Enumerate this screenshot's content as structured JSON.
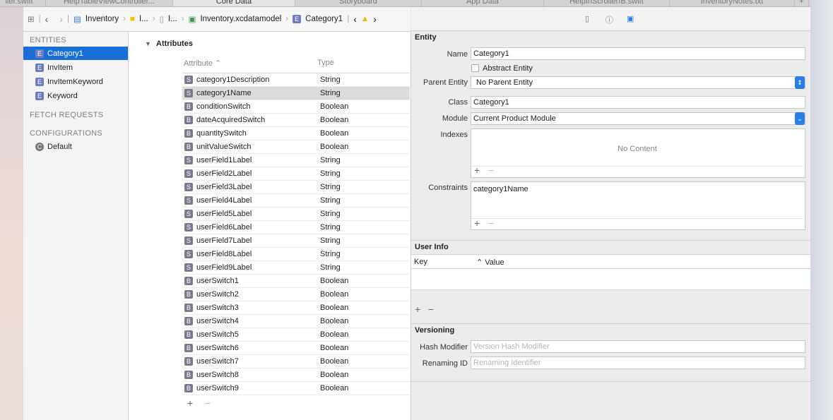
{
  "tabs": [
    "ller.swift",
    "HelpTableViewController...",
    "Core Data",
    "Storyboard",
    "App Data",
    "HelpInScrollerIB.swift",
    "InventoryNotes.txt"
  ],
  "active_tab": 2,
  "breadcrumb": [
    "Inventory",
    "I...",
    "I...",
    "Inventory.xcdatamodel",
    "Category1"
  ],
  "sidebar": {
    "entities_header": "ENTITIES",
    "entities": [
      "Category1",
      "InvItem",
      "InvItemKeyword",
      "Keyword"
    ],
    "selected": 0,
    "fetch_header": "FETCH REQUESTS",
    "config_header": "CONFIGURATIONS",
    "configs": [
      "Default"
    ]
  },
  "attributes": {
    "title": "Attributes",
    "col_attribute": "Attribute",
    "col_type": "Type",
    "selected": 1,
    "rows": [
      [
        "S",
        "category1Description",
        "String"
      ],
      [
        "S",
        "category1Name",
        "String"
      ],
      [
        "B",
        "conditionSwitch",
        "Boolean"
      ],
      [
        "B",
        "dateAcquiredSwitch",
        "Boolean"
      ],
      [
        "B",
        "quantitySwitch",
        "Boolean"
      ],
      [
        "B",
        "unitValueSwitch",
        "Boolean"
      ],
      [
        "S",
        "userField1Label",
        "String"
      ],
      [
        "S",
        "userField2Label",
        "String"
      ],
      [
        "S",
        "userField3Label",
        "String"
      ],
      [
        "S",
        "userField4Label",
        "String"
      ],
      [
        "S",
        "userField5Label",
        "String"
      ],
      [
        "S",
        "userField6Label",
        "String"
      ],
      [
        "S",
        "userField7Label",
        "String"
      ],
      [
        "S",
        "userField8Label",
        "String"
      ],
      [
        "S",
        "userField9Label",
        "String"
      ],
      [
        "B",
        "userSwitch1",
        "Boolean"
      ],
      [
        "B",
        "userSwitch2",
        "Boolean"
      ],
      [
        "B",
        "userSwitch3",
        "Boolean"
      ],
      [
        "B",
        "userSwitch4",
        "Boolean"
      ],
      [
        "B",
        "userSwitch5",
        "Boolean"
      ],
      [
        "B",
        "userSwitch6",
        "Boolean"
      ],
      [
        "B",
        "userSwitch7",
        "Boolean"
      ],
      [
        "B",
        "userSwitch8",
        "Boolean"
      ],
      [
        "B",
        "userSwitch9",
        "Boolean"
      ]
    ]
  },
  "inspector": {
    "entity_header": "Entity",
    "name_label": "Name",
    "name": "Category1",
    "abstract_label": "Abstract Entity",
    "parent_label": "Parent Entity",
    "parent": "No Parent Entity",
    "class_label": "Class",
    "class": "Category1",
    "module_label": "Module",
    "module": "Current Product Module",
    "indexes_label": "Indexes",
    "no_content": "No Content",
    "constraints_label": "Constraints",
    "constraint": "category1Name",
    "userinfo_header": "User Info",
    "key_col": "Key",
    "value_col": "Value",
    "versioning_header": "Versioning",
    "hash_label": "Hash Modifier",
    "hash_placeholder": "Version Hash Modifier",
    "renaming_label": "Renaming ID",
    "renaming_placeholder": "Renaming Identifier"
  },
  "colors": {
    "selection": "#1a6ed8",
    "stepper": "#2a7fe6"
  }
}
